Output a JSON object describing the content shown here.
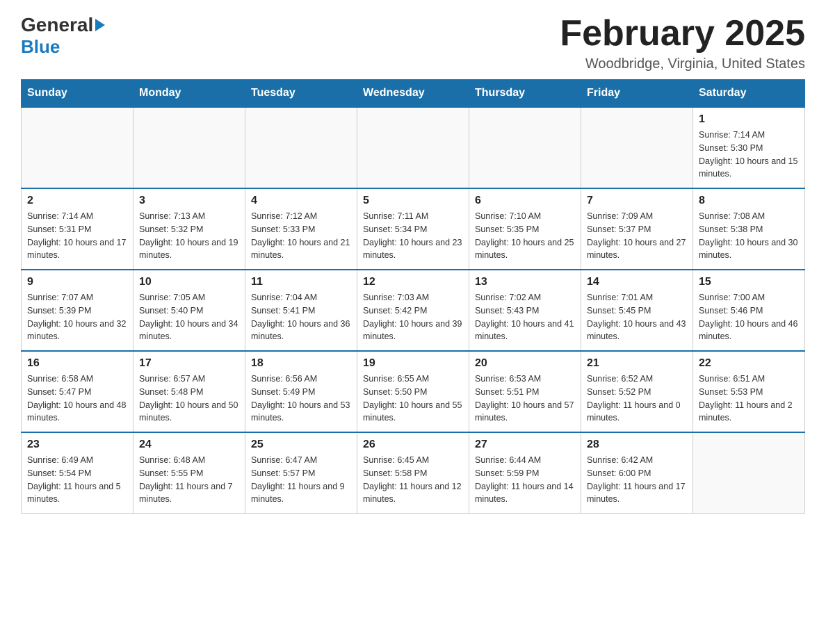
{
  "logo": {
    "line1": "General",
    "arrow": "▶",
    "line2": "Blue"
  },
  "title": "February 2025",
  "location": "Woodbridge, Virginia, United States",
  "days_of_week": [
    "Sunday",
    "Monday",
    "Tuesday",
    "Wednesday",
    "Thursday",
    "Friday",
    "Saturday"
  ],
  "weeks": [
    [
      {
        "day": "",
        "info": ""
      },
      {
        "day": "",
        "info": ""
      },
      {
        "day": "",
        "info": ""
      },
      {
        "day": "",
        "info": ""
      },
      {
        "day": "",
        "info": ""
      },
      {
        "day": "",
        "info": ""
      },
      {
        "day": "1",
        "info": "Sunrise: 7:14 AM\nSunset: 5:30 PM\nDaylight: 10 hours and 15 minutes."
      }
    ],
    [
      {
        "day": "2",
        "info": "Sunrise: 7:14 AM\nSunset: 5:31 PM\nDaylight: 10 hours and 17 minutes."
      },
      {
        "day": "3",
        "info": "Sunrise: 7:13 AM\nSunset: 5:32 PM\nDaylight: 10 hours and 19 minutes."
      },
      {
        "day": "4",
        "info": "Sunrise: 7:12 AM\nSunset: 5:33 PM\nDaylight: 10 hours and 21 minutes."
      },
      {
        "day": "5",
        "info": "Sunrise: 7:11 AM\nSunset: 5:34 PM\nDaylight: 10 hours and 23 minutes."
      },
      {
        "day": "6",
        "info": "Sunrise: 7:10 AM\nSunset: 5:35 PM\nDaylight: 10 hours and 25 minutes."
      },
      {
        "day": "7",
        "info": "Sunrise: 7:09 AM\nSunset: 5:37 PM\nDaylight: 10 hours and 27 minutes."
      },
      {
        "day": "8",
        "info": "Sunrise: 7:08 AM\nSunset: 5:38 PM\nDaylight: 10 hours and 30 minutes."
      }
    ],
    [
      {
        "day": "9",
        "info": "Sunrise: 7:07 AM\nSunset: 5:39 PM\nDaylight: 10 hours and 32 minutes."
      },
      {
        "day": "10",
        "info": "Sunrise: 7:05 AM\nSunset: 5:40 PM\nDaylight: 10 hours and 34 minutes."
      },
      {
        "day": "11",
        "info": "Sunrise: 7:04 AM\nSunset: 5:41 PM\nDaylight: 10 hours and 36 minutes."
      },
      {
        "day": "12",
        "info": "Sunrise: 7:03 AM\nSunset: 5:42 PM\nDaylight: 10 hours and 39 minutes."
      },
      {
        "day": "13",
        "info": "Sunrise: 7:02 AM\nSunset: 5:43 PM\nDaylight: 10 hours and 41 minutes."
      },
      {
        "day": "14",
        "info": "Sunrise: 7:01 AM\nSunset: 5:45 PM\nDaylight: 10 hours and 43 minutes."
      },
      {
        "day": "15",
        "info": "Sunrise: 7:00 AM\nSunset: 5:46 PM\nDaylight: 10 hours and 46 minutes."
      }
    ],
    [
      {
        "day": "16",
        "info": "Sunrise: 6:58 AM\nSunset: 5:47 PM\nDaylight: 10 hours and 48 minutes."
      },
      {
        "day": "17",
        "info": "Sunrise: 6:57 AM\nSunset: 5:48 PM\nDaylight: 10 hours and 50 minutes."
      },
      {
        "day": "18",
        "info": "Sunrise: 6:56 AM\nSunset: 5:49 PM\nDaylight: 10 hours and 53 minutes."
      },
      {
        "day": "19",
        "info": "Sunrise: 6:55 AM\nSunset: 5:50 PM\nDaylight: 10 hours and 55 minutes."
      },
      {
        "day": "20",
        "info": "Sunrise: 6:53 AM\nSunset: 5:51 PM\nDaylight: 10 hours and 57 minutes."
      },
      {
        "day": "21",
        "info": "Sunrise: 6:52 AM\nSunset: 5:52 PM\nDaylight: 11 hours and 0 minutes."
      },
      {
        "day": "22",
        "info": "Sunrise: 6:51 AM\nSunset: 5:53 PM\nDaylight: 11 hours and 2 minutes."
      }
    ],
    [
      {
        "day": "23",
        "info": "Sunrise: 6:49 AM\nSunset: 5:54 PM\nDaylight: 11 hours and 5 minutes."
      },
      {
        "day": "24",
        "info": "Sunrise: 6:48 AM\nSunset: 5:55 PM\nDaylight: 11 hours and 7 minutes."
      },
      {
        "day": "25",
        "info": "Sunrise: 6:47 AM\nSunset: 5:57 PM\nDaylight: 11 hours and 9 minutes."
      },
      {
        "day": "26",
        "info": "Sunrise: 6:45 AM\nSunset: 5:58 PM\nDaylight: 11 hours and 12 minutes."
      },
      {
        "day": "27",
        "info": "Sunrise: 6:44 AM\nSunset: 5:59 PM\nDaylight: 11 hours and 14 minutes."
      },
      {
        "day": "28",
        "info": "Sunrise: 6:42 AM\nSunset: 6:00 PM\nDaylight: 11 hours and 17 minutes."
      },
      {
        "day": "",
        "info": ""
      }
    ]
  ]
}
